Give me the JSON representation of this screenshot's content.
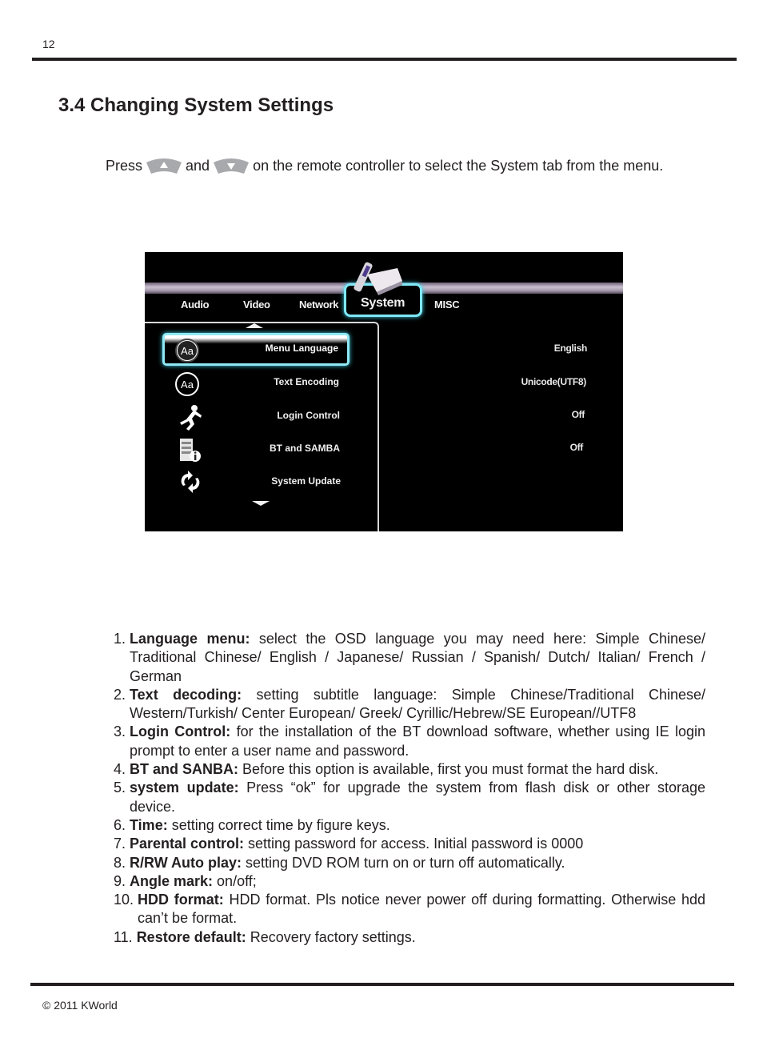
{
  "page": {
    "number": "12",
    "title": "3.4 Changing System Settings",
    "footer": "© 2011 KWorld"
  },
  "instruction": {
    "press": "Press",
    "and": "and",
    "rest": "on the remote controller to select the System tab from the menu.",
    "icons": [
      "up-arrow-button-icon",
      "down-arrow-button-icon"
    ]
  },
  "tv": {
    "tabs": [
      {
        "label": "Audio",
        "active": false
      },
      {
        "label": "Video",
        "active": false
      },
      {
        "label": "Network",
        "active": false
      },
      {
        "label": "System",
        "active": true
      },
      {
        "label": "MISC",
        "active": false
      }
    ],
    "items": [
      {
        "label": "Menu Language",
        "icon": "font-aa-icon",
        "value": "English",
        "selected": true
      },
      {
        "label": "Text Encoding",
        "icon": "font-aa-icon",
        "value": "Unicode(UTF8)",
        "selected": false
      },
      {
        "label": "Login Control",
        "icon": "running-person-icon",
        "value": "Off",
        "selected": false
      },
      {
        "label": "BT and SAMBA",
        "icon": "server-info-icon",
        "value": "Off",
        "selected": false
      },
      {
        "label": "System Update",
        "icon": "refresh-arrows-icon",
        "value": "",
        "selected": false
      }
    ],
    "colors": {
      "highlight": "#7fe7f5",
      "background": "#000000",
      "text": "#f0f0f0"
    }
  },
  "list": [
    {
      "num": "1. ",
      "term": "Language menu:",
      "text": " select the OSD language you may need here: Simple Chinese/ Traditional Chinese/ English / Japanese/ Russian / Spanish/ Dutch/ Italian/ French / German"
    },
    {
      "num": "2. ",
      "term": "Text decoding:",
      "text": " setting subtitle language: Simple Chinese/Traditional Chinese/ Western/Turkish/ Center European/ Greek/ Cyrillic/Hebrew/SE European//UTF8"
    },
    {
      "num": "3. ",
      "term": "Login Control:",
      "text": " for the installation of the BT download software, whether using IE login prompt to enter a user name and password."
    },
    {
      "num": "4. ",
      "term": "BT and SANBA:",
      "text": " Before this option is available, first you must format the hard disk."
    },
    {
      "num": "5. ",
      "term": "system update:",
      "text": " Press “ok” for upgrade the system from flash disk or other storage device."
    },
    {
      "num": "6. ",
      "term": "Time:",
      "text": " setting correct time by figure keys."
    },
    {
      "num": "7. ",
      "term": "Parental control:",
      "text": " setting password for access. Initial password is 0000"
    },
    {
      "num": "8. ",
      "term": "R/RW Auto play:",
      "text": " setting DVD ROM turn on or turn off automatically."
    },
    {
      "num": "9. ",
      "term": "Angle mark:",
      "text": " on/off;"
    },
    {
      "num": "10. ",
      "term": "HDD format:",
      "text": " HDD format. Pls notice never power off during formatting. Otherwise hdd can’t be format."
    },
    {
      "num": "11. ",
      "term": "Restore default:",
      "text": " Recovery factory settings."
    }
  ]
}
